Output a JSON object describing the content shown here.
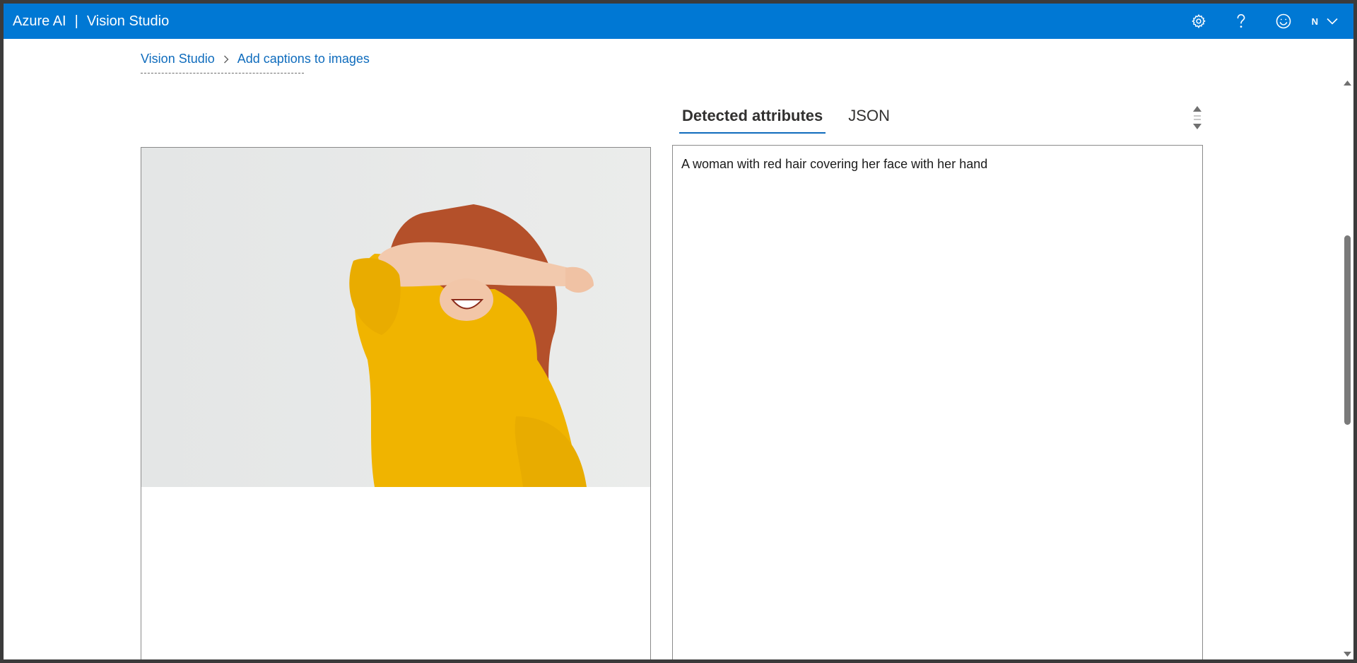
{
  "app": {
    "brand": "Azure AI",
    "separator": "|",
    "product": "Vision Studio"
  },
  "header": {
    "icons": [
      "gear-icon",
      "help-icon",
      "feedback-smiley-icon"
    ],
    "user_initial": "N",
    "colors": {
      "bar": "#0078d4",
      "text": "#ffffff"
    }
  },
  "breadcrumb": {
    "items": [
      "Vision Studio",
      "Add captions to images"
    ]
  },
  "tabs": [
    {
      "label": "Detected attributes",
      "active": true
    },
    {
      "label": "JSON",
      "active": false
    }
  ],
  "result": {
    "caption": "A woman with red hair covering her face with her hand"
  },
  "accent": "#0f6cbd"
}
